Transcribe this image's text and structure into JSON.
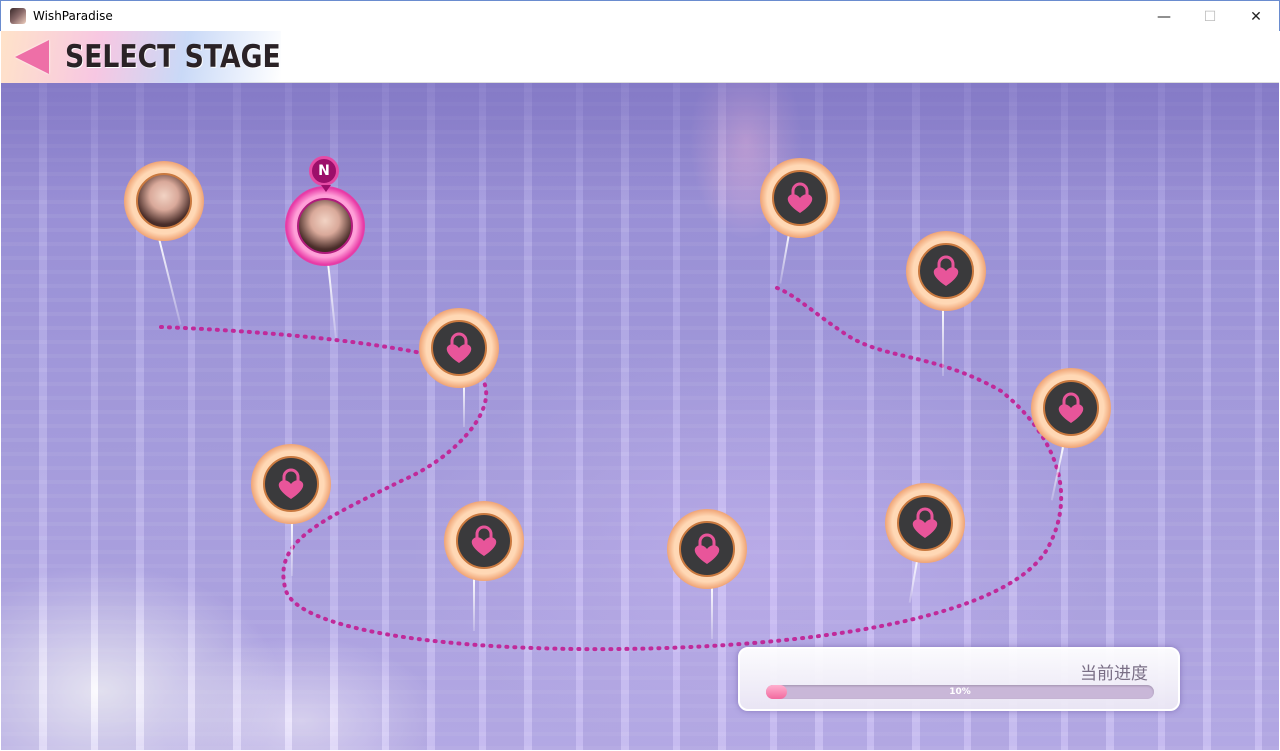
{
  "window": {
    "title": "WishParadise",
    "minimize_glyph": "—",
    "maximize_glyph": "☐",
    "close_glyph": "✕"
  },
  "header": {
    "title": "SELECT STAGE",
    "back_icon": "back-arrow-icon"
  },
  "colors": {
    "accent_pink": "#ee6fa7",
    "node_ring": "#ffd8b5",
    "path_dot": "#c02a9a",
    "lock_heart": "#e8559a"
  },
  "stages": [
    {
      "id": 1,
      "state": "cleared",
      "icon": "character-portrait"
    },
    {
      "id": 2,
      "state": "current",
      "icon": "character-portrait",
      "badge": "N"
    },
    {
      "id": 3,
      "state": "locked",
      "icon": "heart-lock-icon"
    },
    {
      "id": 4,
      "state": "locked",
      "icon": "heart-lock-icon"
    },
    {
      "id": 5,
      "state": "locked",
      "icon": "heart-lock-icon"
    },
    {
      "id": 6,
      "state": "locked",
      "icon": "heart-lock-icon"
    },
    {
      "id": 7,
      "state": "locked",
      "icon": "heart-lock-icon"
    },
    {
      "id": 8,
      "state": "locked",
      "icon": "heart-lock-icon"
    },
    {
      "id": 9,
      "state": "locked",
      "icon": "heart-lock-icon"
    },
    {
      "id": 10,
      "state": "locked",
      "icon": "heart-lock-icon"
    },
    {
      "id": 11,
      "state": "locked",
      "icon": "heart-lock-icon"
    }
  ],
  "progress": {
    "label": "当前进度",
    "value_text": "10%",
    "fraction": 0.1
  }
}
